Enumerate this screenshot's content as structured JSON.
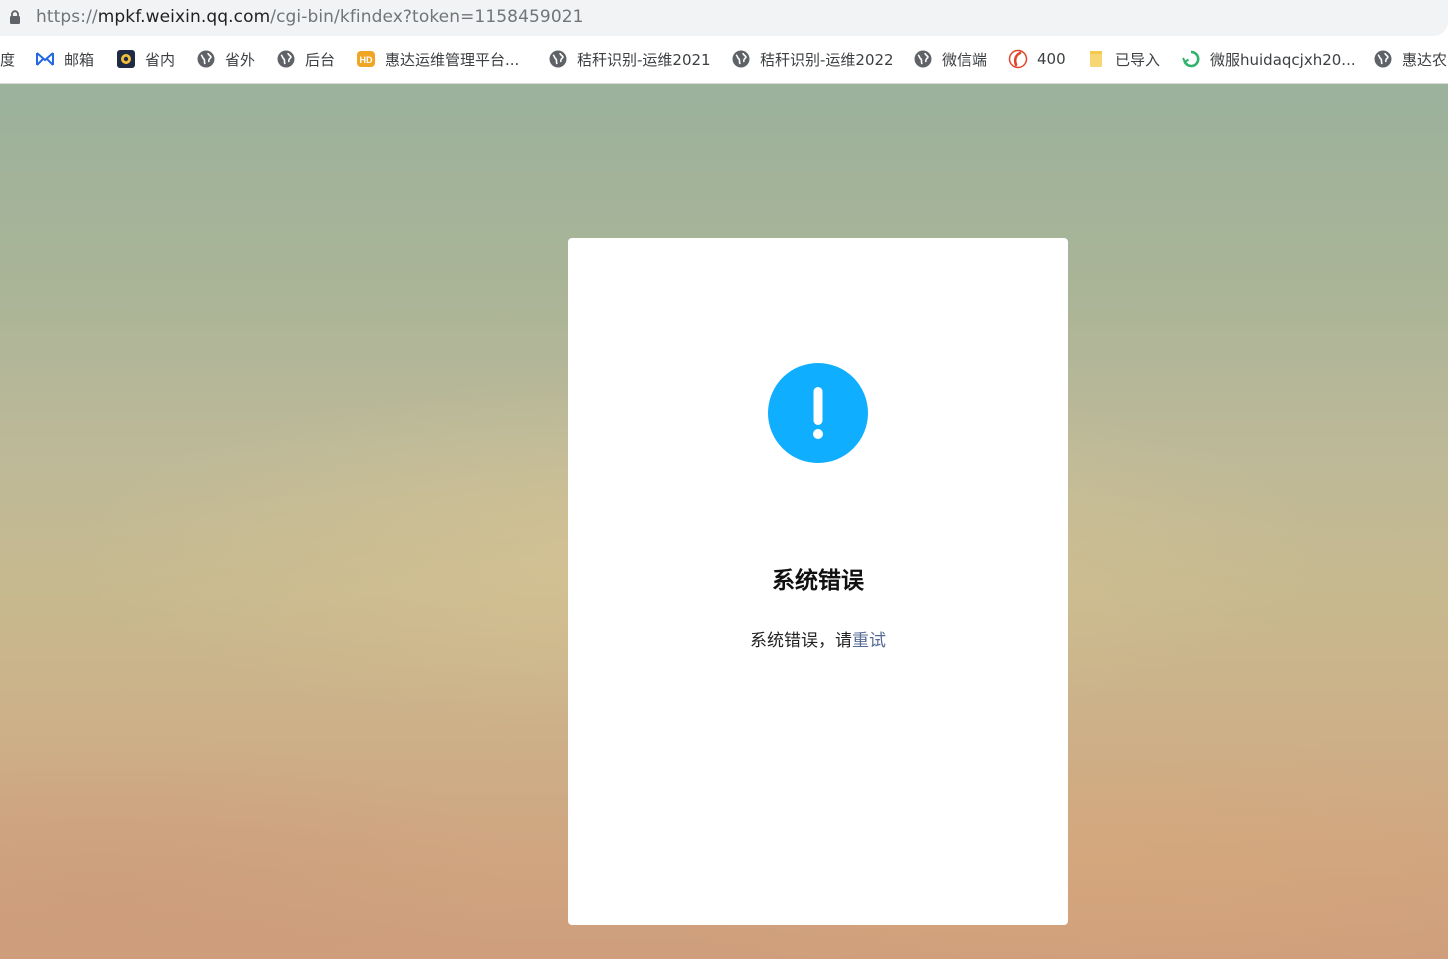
{
  "browser": {
    "url_scheme": "https://",
    "url_domain": "mpkf.weixin.qq.com",
    "url_path": "/cgi-bin/kfindex?token=1158459021"
  },
  "bookmarks": [
    {
      "label": "度",
      "icon": "none"
    },
    {
      "label": "邮箱",
      "icon": "mail-logo-icon"
    },
    {
      "label": "省内",
      "icon": "dark-badge-icon"
    },
    {
      "label": "省外",
      "icon": "globe-icon"
    },
    {
      "label": "后台",
      "icon": "globe-icon"
    },
    {
      "label": "惠达运维管理平台...",
      "icon": "hd-logo-icon"
    },
    {
      "label": "秸秆识别-运维2021",
      "icon": "globe-icon"
    },
    {
      "label": "秸秆识别-运维2022",
      "icon": "globe-icon"
    },
    {
      "label": "微信端",
      "icon": "globe-icon"
    },
    {
      "label": "400",
      "icon": "red-phone-icon"
    },
    {
      "label": "已导入",
      "icon": "folder-icon"
    },
    {
      "label": "微服huidaqcjxh20...",
      "icon": "green-recycle-icon"
    },
    {
      "label": "惠达农",
      "icon": "globe-icon"
    }
  ],
  "error": {
    "title": "系统错误",
    "message_prefix": "系统错误，请",
    "retry_link": "重试"
  },
  "colors": {
    "alert_blue": "#10aeff",
    "link": "#576b95"
  }
}
